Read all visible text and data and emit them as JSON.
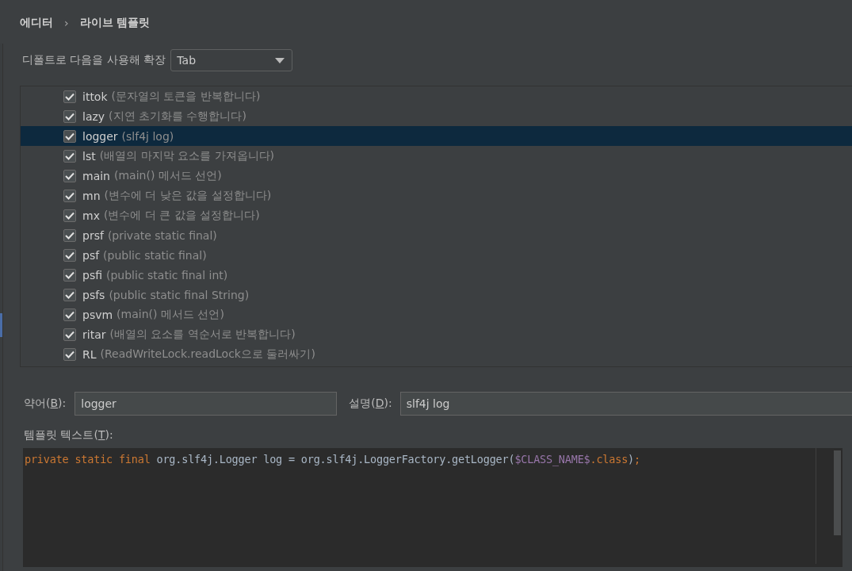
{
  "breadcrumb": [
    {
      "label": "에디터"
    },
    {
      "label": "라이브 템플릿"
    }
  ],
  "breadcrumb_separator": "›",
  "expand_with": {
    "label": "디폴트로 다음을 사용해 확장",
    "value": "Tab"
  },
  "templates": [
    {
      "abbreviation": "ittok",
      "description": "(문자열의 토큰을 반복합니다)",
      "checked": true,
      "selected": false
    },
    {
      "abbreviation": "lazy",
      "description": "(지연 초기화를 수행합니다)",
      "checked": true,
      "selected": false
    },
    {
      "abbreviation": "logger",
      "description": "(slf4j log)",
      "checked": true,
      "selected": true
    },
    {
      "abbreviation": "lst",
      "description": "(배열의 마지막 요소를 가져옵니다)",
      "checked": true,
      "selected": false
    },
    {
      "abbreviation": "main",
      "description": "(main() 메서드 선언)",
      "checked": true,
      "selected": false
    },
    {
      "abbreviation": "mn",
      "description": "(변수에 더 낮은 값을 설정합니다)",
      "checked": true,
      "selected": false
    },
    {
      "abbreviation": "mx",
      "description": "(변수에 더 큰 값을 설정합니다)",
      "checked": true,
      "selected": false
    },
    {
      "abbreviation": "prsf",
      "description": "(private static final)",
      "checked": true,
      "selected": false
    },
    {
      "abbreviation": "psf",
      "description": "(public static final)",
      "checked": true,
      "selected": false
    },
    {
      "abbreviation": "psfi",
      "description": "(public static final int)",
      "checked": true,
      "selected": false
    },
    {
      "abbreviation": "psfs",
      "description": "(public static final String)",
      "checked": true,
      "selected": false
    },
    {
      "abbreviation": "psvm",
      "description": "(main() 메서드 선언)",
      "checked": true,
      "selected": false
    },
    {
      "abbreviation": "ritar",
      "description": "(배열의 요소를 역순서로 반복합니다)",
      "checked": true,
      "selected": false
    },
    {
      "abbreviation": "RL",
      "description": "(ReadWriteLock.readLock으로 둘러싸기)",
      "checked": true,
      "selected": false
    }
  ],
  "abbreviation_field": {
    "label_before": "약어(",
    "mnemonic": "B",
    "label_after": "):",
    "value": "logger"
  },
  "description_field": {
    "label_before": "설명(",
    "mnemonic": "D",
    "label_after": "):",
    "value": "slf4j log"
  },
  "template_text": {
    "label_before": "템플릿 텍스트(",
    "mnemonic": "T",
    "label_after": "):",
    "tokens": [
      {
        "text": "private static final",
        "kind": "keyword"
      },
      {
        "text": " org.slf4j.Logger log = org.slf4j.LoggerFactory.getLogger(",
        "kind": "plain"
      },
      {
        "text": "$CLASS_NAME$",
        "kind": "variable"
      },
      {
        "text": ".class",
        "kind": "keyword"
      },
      {
        "text": ")",
        "kind": "plain"
      },
      {
        "text": ";",
        "kind": "keyword"
      }
    ]
  }
}
